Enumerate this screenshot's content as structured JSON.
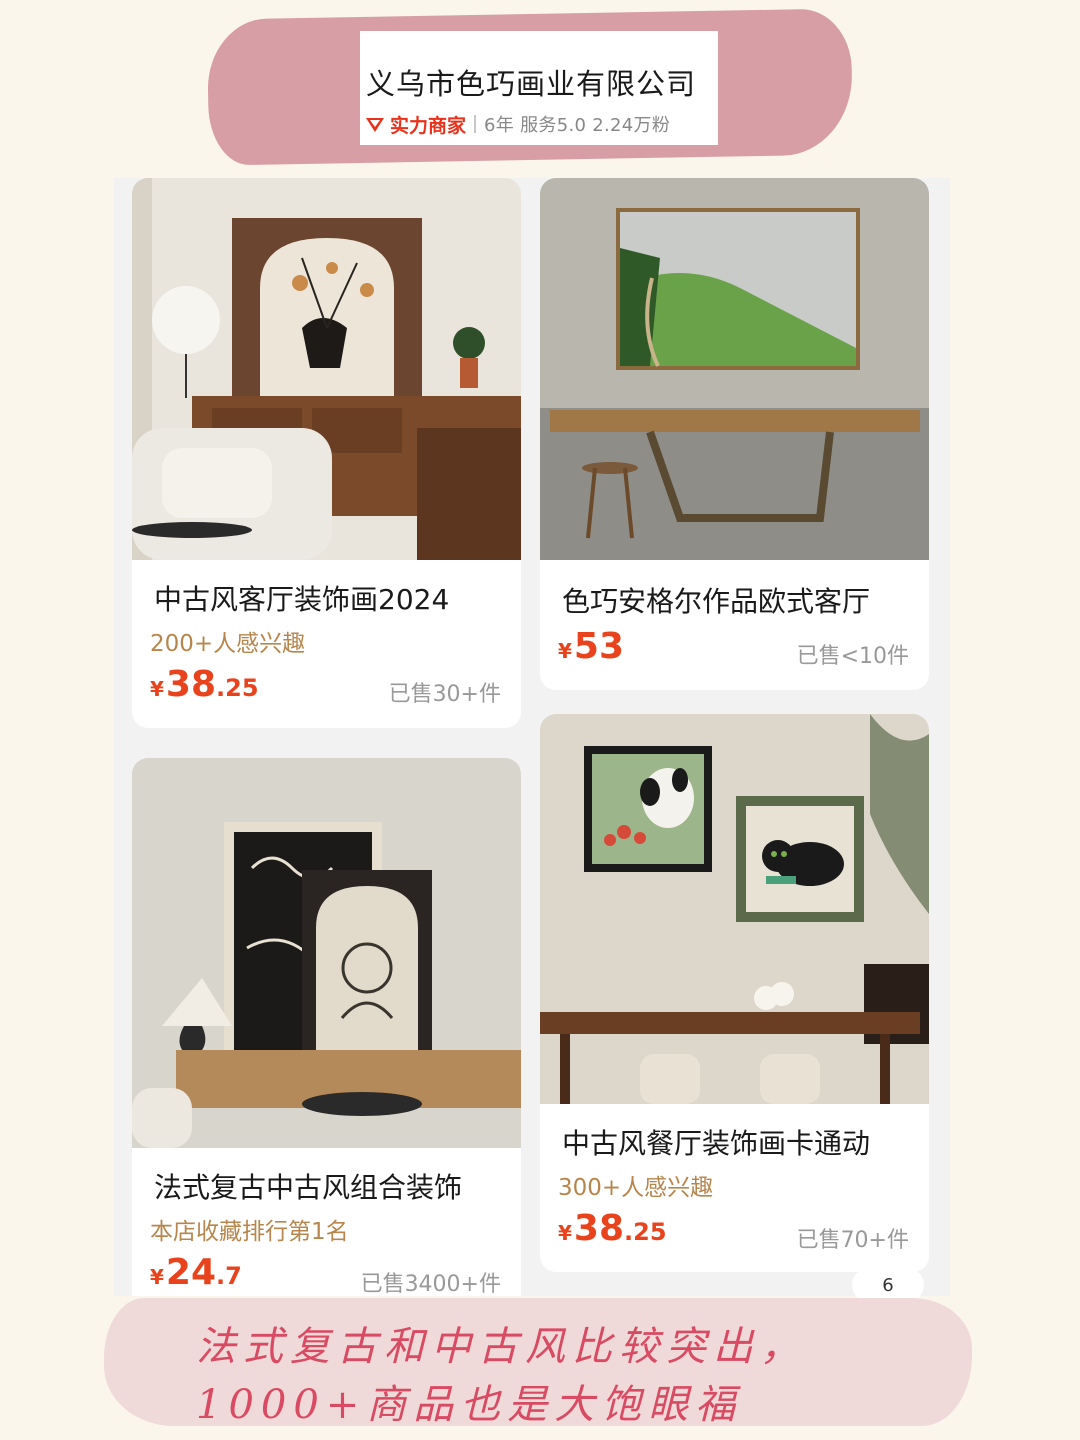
{
  "shop": {
    "name": "义乌市色巧画业有限公司",
    "badge": "实力商家",
    "meta": "6年  服务5.0  2.24万粉"
  },
  "products": [
    {
      "title": "中古风客厅装饰画2024",
      "tag": "200+人感兴趣",
      "price_yen": "¥",
      "price_int": "38",
      "price_dec": ".25",
      "sold": "已售30+件"
    },
    {
      "title": "色巧安格尔作品欧式客厅",
      "tag": "",
      "price_yen": "¥",
      "price_int": "53",
      "price_dec": "",
      "sold": "已售<10件"
    },
    {
      "title": "法式复古中古风组合装饰",
      "tag": "本店收藏排行第1名",
      "price_yen": "¥",
      "price_int": "24",
      "price_dec": ".7",
      "sold": "已售3400+件"
    },
    {
      "title": "中古风餐厅装饰画卡通动",
      "tag": "300+人感兴趣",
      "price_yen": "¥",
      "price_int": "38",
      "price_dec": ".25",
      "sold": "已售70+件"
    }
  ],
  "page_indicator": "6",
  "note": {
    "line1": "法式复古和中古风比较突出，",
    "line2": "1000+商品也是大饱眼福"
  },
  "colors": {
    "banner": "#d79ea6",
    "accent_red": "#e8431c",
    "tag_gold": "#b8864c",
    "note_text": "#d94a63"
  }
}
